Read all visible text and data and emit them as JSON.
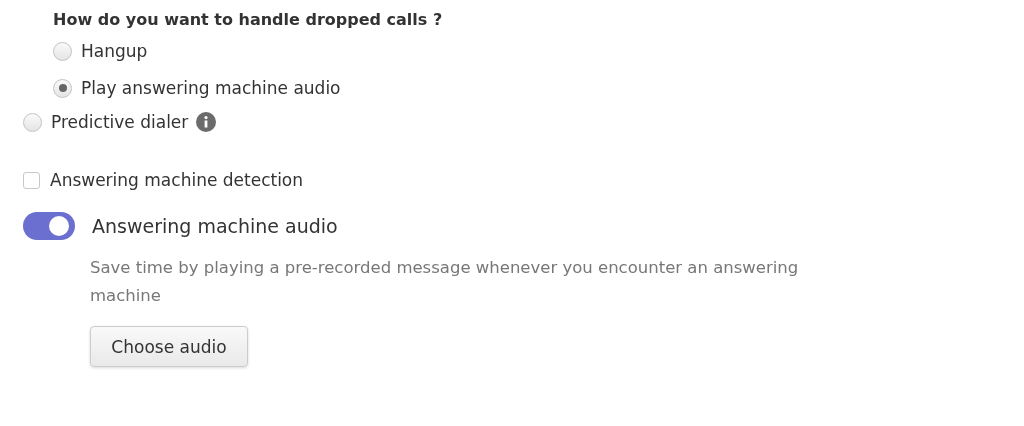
{
  "dropped_calls": {
    "question": "How do you want to handle dropped calls ?",
    "options": [
      {
        "label": "Hangup",
        "selected": false
      },
      {
        "label": "Play answering machine audio",
        "selected": true
      }
    ]
  },
  "predictive_dialer": {
    "label": "Predictive dialer",
    "selected": false
  },
  "answering_machine_detection": {
    "label": "Answering machine detection",
    "checked": false
  },
  "answering_machine_audio": {
    "label": "Answering machine audio",
    "on": true,
    "description": "Save time by playing a pre-recorded message whenever you encounter an answering machine",
    "button": "Choose audio"
  }
}
